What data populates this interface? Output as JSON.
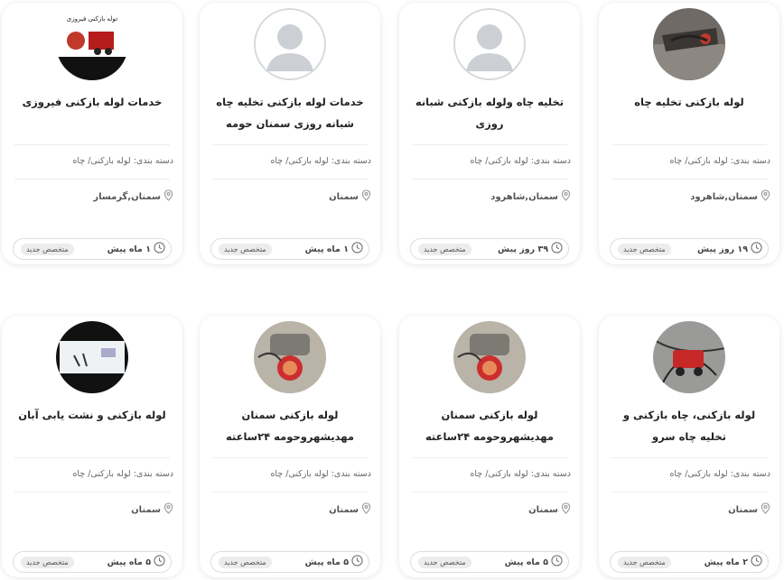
{
  "labels": {
    "category_prefix": "دسته بندی:",
    "badge": "متخصص جدید"
  },
  "cards": [
    {
      "title": "لوله بازکنی تخلیه چاه",
      "category": "لوله بازکنی/ چاه",
      "location": "سمنان,شاهرود",
      "time": "۱۹ روز پیش",
      "avatar": "photo-tools-red"
    },
    {
      "title": "تخلیه چاه ولوله بازکنی شبانه روزی",
      "category": "لوله بازکنی/ چاه",
      "location": "سمنان,شاهرود",
      "time": "۳۹ روز پیش",
      "avatar": "placeholder-user"
    },
    {
      "title": "خدمات لوله بازکنی تخلیه چاه شبانه روزی سمنان حومه",
      "category": "لوله بازکنی/ چاه",
      "location": "سمنان",
      "time": "۱ ماه پیش",
      "avatar": "placeholder-user"
    },
    {
      "title": "خدمات لوله بازکنی فیروزی",
      "category": "لوله بازکنی/ چاه",
      "location": "سمنان,گرمسار",
      "time": "۱ ماه پیش",
      "avatar": "logo-firoozi",
      "avatar_text": "لوله بازکنی فیروزی"
    },
    {
      "title": "لوله بازکنی، چاه بازکنی و تخلیه چاه سرو",
      "category": "لوله بازکنی/ چاه",
      "location": "سمنان",
      "time": "۲ ماه پیش",
      "avatar": "photo-machine-red"
    },
    {
      "title": "لوله بازکنی سمنان مهدیشهروحومه ۲۴ساعته",
      "category": "لوله بازکنی/ چاه",
      "location": "سمنان",
      "time": "۵ ماه پیش",
      "avatar": "photo-machine-floor"
    },
    {
      "title": "لوله بازکنی سمنان مهدیشهروحومه ۲۴ساعته",
      "category": "لوله بازکنی/ چاه",
      "location": "سمنان",
      "time": "۵ ماه پیش",
      "avatar": "photo-machine-floor"
    },
    {
      "title": "لوله بازکنی و نشت یابی آبان",
      "category": "لوله بازکنی/ چاه",
      "location": "سمنان",
      "time": "۵ ماه پیش",
      "avatar": "photo-screen"
    }
  ]
}
